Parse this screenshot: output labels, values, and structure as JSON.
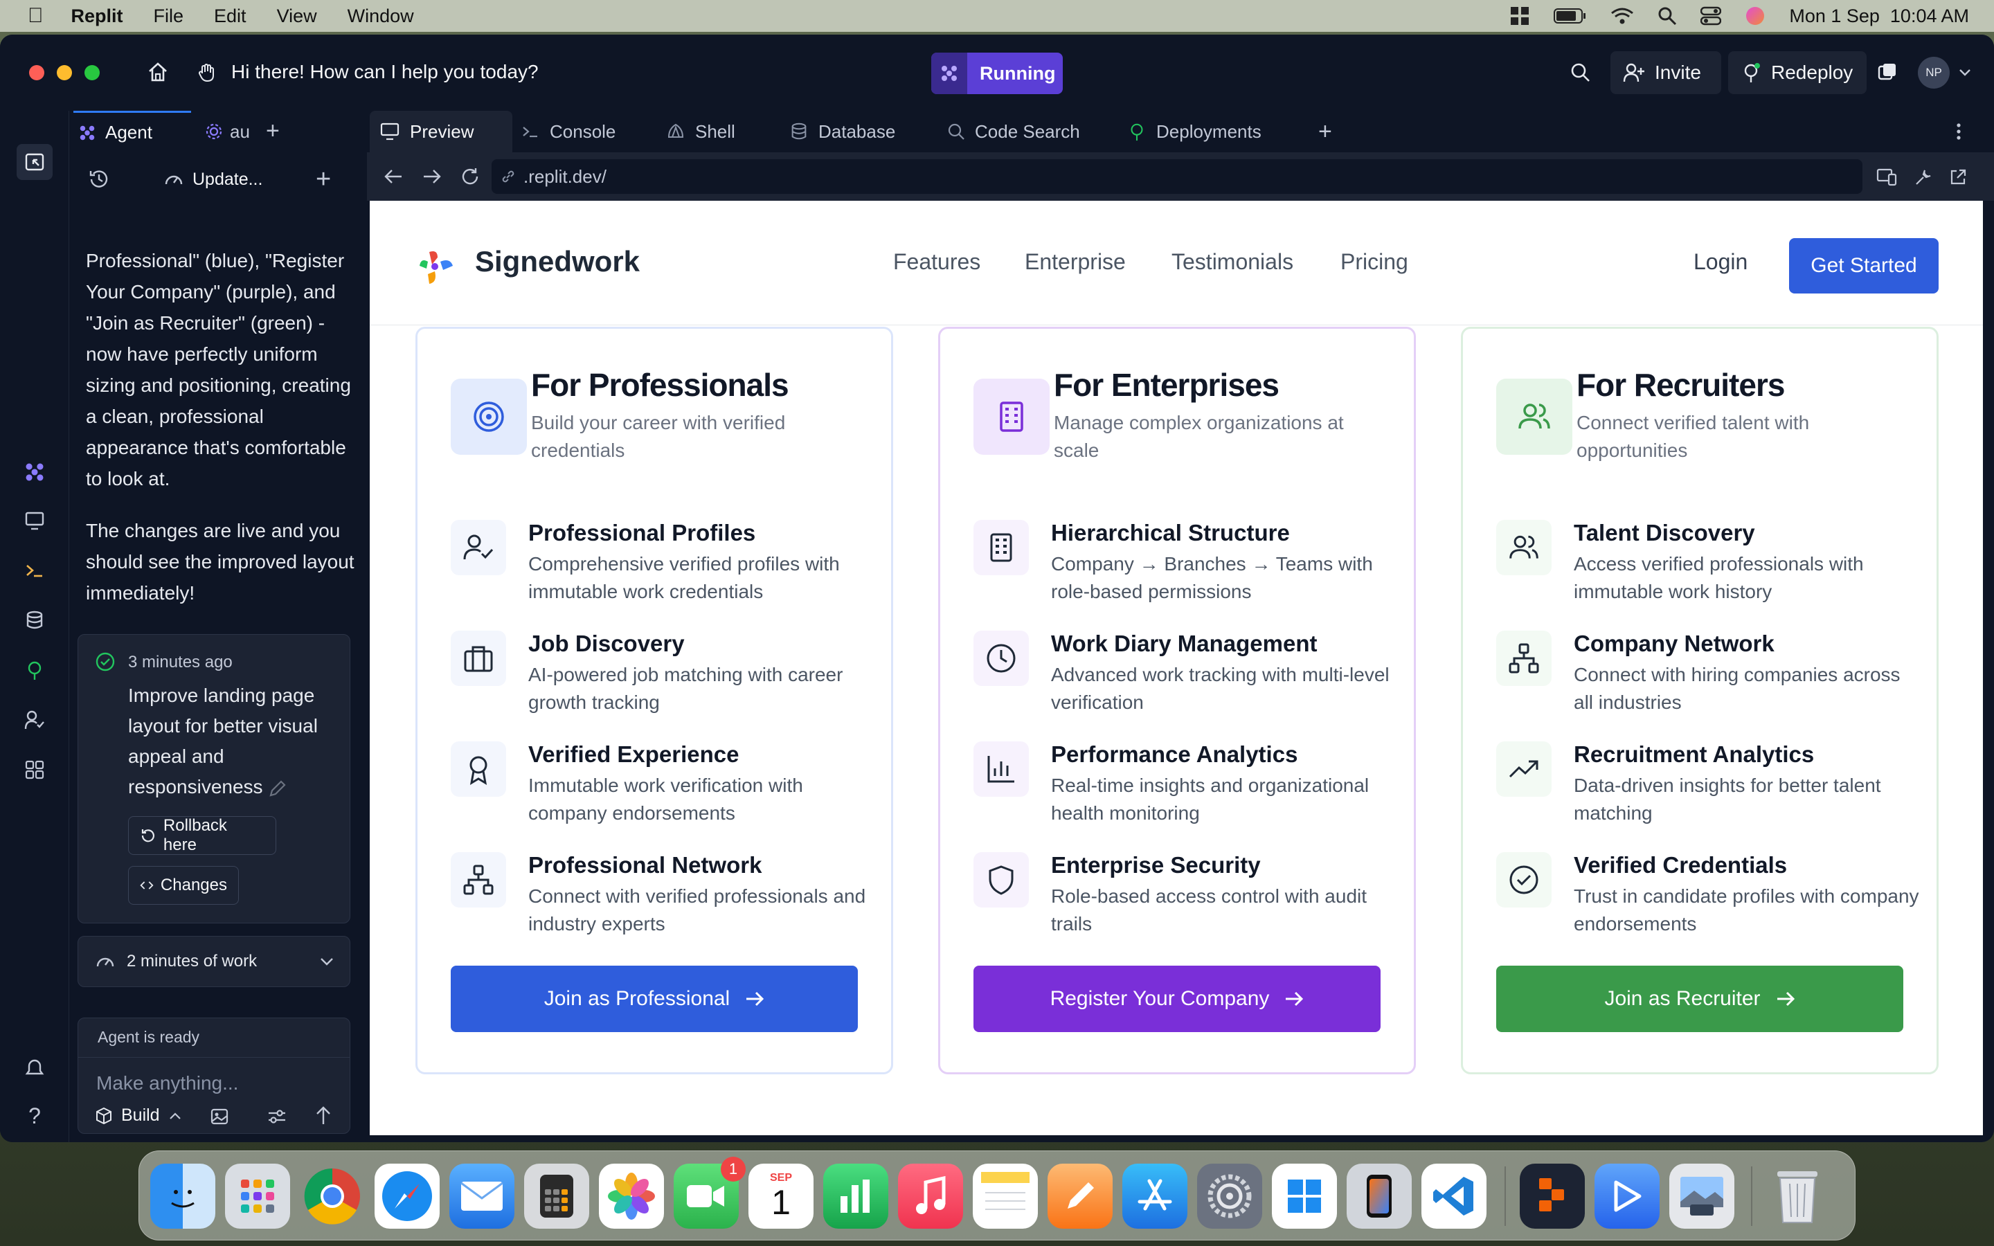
{
  "menubar": {
    "app": "Replit",
    "items": [
      "File",
      "Edit",
      "View",
      "Window"
    ],
    "datetime": "Mon 1 Sep  10:04 AM"
  },
  "titlebar": {
    "greeting": "Hi there! How can I help you today?",
    "status": "Running",
    "invite": "Invite",
    "redeploy": "Redeploy",
    "avatar": "NP"
  },
  "agent_panel": {
    "tab_agent": "Agent",
    "tab_other": "au",
    "update": "Update...",
    "message_p1": "Professional\" (blue), \"Register Your Company\" (purple), and \"Join as Recruiter\" (green) - now have perfectly uniform sizing and positioning, creating a clean, professional appearance that's comfortable to look at.",
    "message_p2": "The changes are live and you should see the improved layout immediately!",
    "checkpoint_time": "3 minutes ago",
    "checkpoint_text": "Improve landing page layout for better visual appeal and responsiveness",
    "rollback": "Rollback here",
    "changes": "Changes",
    "work_time": "2 minutes of work",
    "agent_ready": "Agent is ready",
    "input_placeholder": "Make anything...",
    "build": "Build"
  },
  "tabs": [
    "Preview",
    "Console",
    "Shell",
    "Database",
    "Code Search",
    "Deployments"
  ],
  "url": ".replit.dev/",
  "site": {
    "brand": "Signedwork",
    "nav": [
      "Features",
      "Enterprise",
      "Testimonials",
      "Pricing"
    ],
    "login": "Login",
    "get_started": "Get Started",
    "cards": [
      {
        "title": "For Professionals",
        "subtitle": "Build your career with verified credentials",
        "accent": "#2f5ddc",
        "features": [
          {
            "title": "Professional Profiles",
            "desc": "Comprehensive verified profiles with immutable work credentials"
          },
          {
            "title": "Job Discovery",
            "desc": "AI-powered job matching with career growth tracking"
          },
          {
            "title": "Verified Experience",
            "desc": "Immutable work verification with company endorsements"
          },
          {
            "title": "Professional Network",
            "desc": "Connect with verified professionals and industry experts"
          }
        ],
        "cta": "Join as Professional"
      },
      {
        "title": "For Enterprises",
        "subtitle": "Manage complex organizations at scale",
        "accent": "#7a2fd8",
        "features": [
          {
            "title": "Hierarchical Structure",
            "desc": "Company → Branches → Teams with role-based permissions"
          },
          {
            "title": "Work Diary Management",
            "desc": "Advanced work tracking with multi-level verification"
          },
          {
            "title": "Performance Analytics",
            "desc": "Real-time insights and organizational health monitoring"
          },
          {
            "title": "Enterprise Security",
            "desc": "Role-based access control with audit trails"
          }
        ],
        "cta": "Register Your Company"
      },
      {
        "title": "For Recruiters",
        "subtitle": "Connect verified talent with opportunities",
        "accent": "#3a9a4a",
        "features": [
          {
            "title": "Talent Discovery",
            "desc": "Access verified professionals with immutable work history"
          },
          {
            "title": "Company Network",
            "desc": "Connect with hiring companies across all industries"
          },
          {
            "title": "Recruitment Analytics",
            "desc": "Data-driven insights for better talent matching"
          },
          {
            "title": "Verified Credentials",
            "desc": "Trust in candidate profiles with company endorsements"
          }
        ],
        "cta": "Join as Recruiter"
      }
    ]
  },
  "dock": {
    "facetime_badge": "1",
    "calendar_month": "SEP",
    "calendar_day": "1"
  }
}
